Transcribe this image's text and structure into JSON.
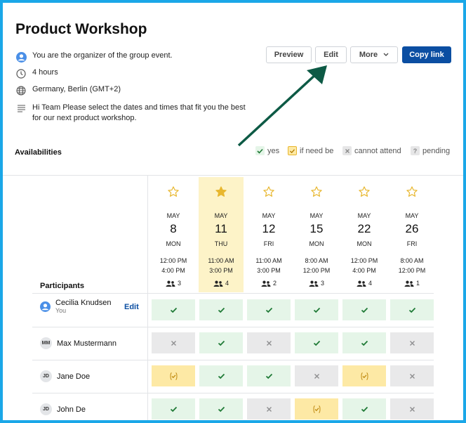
{
  "title": "Product Workshop",
  "info": {
    "organizer": "You are the organizer of the group event.",
    "duration": "4 hours",
    "timezone": "Germany, Berlin (GMT+2)",
    "description": "Hi Team Please select the dates and times that fit you the best for our next product workshop."
  },
  "buttons": {
    "preview": "Preview",
    "edit": "Edit",
    "more": "More",
    "copy_link": "Copy link"
  },
  "availabilities_label": "Availabilities",
  "legend": {
    "yes": "yes",
    "if_need_be": "if need be",
    "cannot_attend": "cannot attend",
    "pending": "pending"
  },
  "colors": {
    "accent": "#0b4ea2",
    "yes_bg": "#e5f5e8",
    "maybe_bg": "#fde9a5",
    "no_bg": "#e9e9ea",
    "highlight": "#fdf3c8",
    "arrow": "#0d5a45"
  },
  "dates": [
    {
      "month": "MAY",
      "day": "8",
      "weekday": "MON",
      "start": "12:00 PM",
      "end": "4:00 PM",
      "count": "3",
      "starred": false
    },
    {
      "month": "MAY",
      "day": "11",
      "weekday": "THU",
      "start": "11:00 AM",
      "end": "3:00 PM",
      "count": "4",
      "starred": true
    },
    {
      "month": "MAY",
      "day": "12",
      "weekday": "FRI",
      "start": "11:00 AM",
      "end": "3:00 PM",
      "count": "2",
      "starred": false
    },
    {
      "month": "MAY",
      "day": "15",
      "weekday": "MON",
      "start": "8:00 AM",
      "end": "12:00 PM",
      "count": "3",
      "starred": false
    },
    {
      "month": "MAY",
      "day": "22",
      "weekday": "MON",
      "start": "12:00 PM",
      "end": "4:00 PM",
      "count": "4",
      "starred": false
    },
    {
      "month": "MAY",
      "day": "26",
      "weekday": "FRI",
      "start": "8:00 AM",
      "end": "12:00 PM",
      "count": "1",
      "starred": false
    }
  ],
  "participants_label": "Participants",
  "participants": [
    {
      "name": "Cecilia Knudsen",
      "sub": "You",
      "initials": "",
      "edit_label": "Edit",
      "answers": [
        "yes",
        "yes",
        "yes",
        "yes",
        "yes",
        "yes"
      ]
    },
    {
      "name": "Max Mustermann",
      "sub": "",
      "initials": "MM",
      "edit_label": "",
      "answers": [
        "no",
        "yes",
        "no",
        "yes",
        "yes",
        "no"
      ]
    },
    {
      "name": "Jane Doe",
      "sub": "",
      "initials": "JD",
      "edit_label": "",
      "answers": [
        "maybe",
        "yes",
        "yes",
        "no",
        "maybe",
        "no"
      ]
    },
    {
      "name": "John De",
      "sub": "",
      "initials": "JD",
      "edit_label": "",
      "answers": [
        "yes",
        "yes",
        "no",
        "maybe",
        "yes",
        "no"
      ]
    }
  ]
}
